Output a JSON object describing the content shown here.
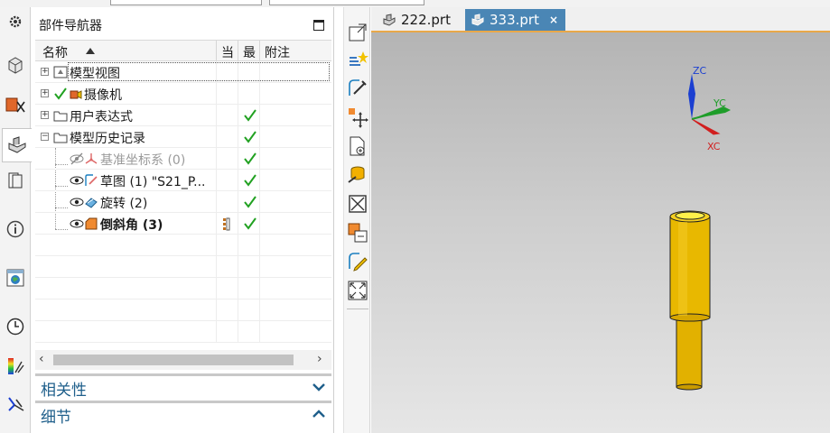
{
  "navigator": {
    "title": "部件导航器",
    "columns": {
      "name": "名称",
      "current": "当",
      "latest": "最",
      "notes": "附注"
    },
    "rows": [
      {
        "label": "模型视图",
        "expander": "+",
        "check": false
      },
      {
        "label": "摄像机",
        "expander": "+",
        "check": false
      },
      {
        "label": "用户表达式",
        "expander": "+",
        "check": true
      },
      {
        "label": "模型历史记录",
        "expander": "−",
        "check": true
      },
      {
        "label": "基准坐标系 (0)",
        "check": true
      },
      {
        "label": "草图 (1) \"S21_P...",
        "check": true
      },
      {
        "label": "旋转 (2)",
        "check": true
      },
      {
        "label": "倒斜角 (3)",
        "check": true
      }
    ],
    "sections": {
      "dependencies": "相关性",
      "details": "细节"
    }
  },
  "tabs": [
    {
      "label": "222.prt",
      "active": false
    },
    {
      "label": "333.prt",
      "active": true,
      "close": "×"
    }
  ],
  "viewport": {
    "axes": {
      "z": "ZC",
      "y": "YC",
      "x": "XC"
    }
  },
  "colors": {
    "active_tab": "#4a86b5",
    "check_green": "#21a121",
    "section_title": "#1f5f8b",
    "part_yellow": "#e8b400",
    "axis_z": "#1b3fd1",
    "axis_y": "#1f9d2a",
    "axis_x": "#d11f1f"
  }
}
